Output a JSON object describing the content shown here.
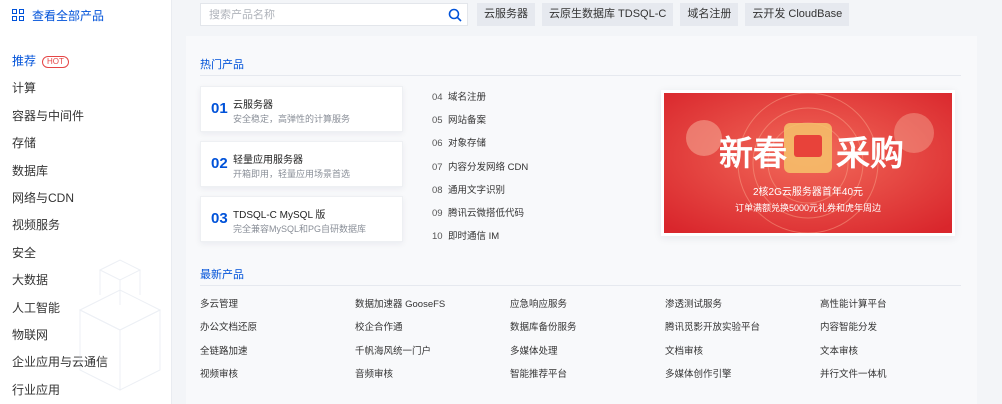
{
  "sidebar": {
    "all_products": "查看全部产品",
    "categories": [
      {
        "label": "推荐",
        "badge": "HOT",
        "active": true
      },
      {
        "label": "计算"
      },
      {
        "label": "容器与中间件"
      },
      {
        "label": "存储"
      },
      {
        "label": "数据库"
      },
      {
        "label": "网络与CDN"
      },
      {
        "label": "视频服务"
      },
      {
        "label": "安全"
      },
      {
        "label": "大数据"
      },
      {
        "label": "人工智能"
      },
      {
        "label": "物联网"
      },
      {
        "label": "企业应用与云通信"
      },
      {
        "label": "行业应用"
      }
    ]
  },
  "search": {
    "placeholder": "搜索产品名称",
    "chips": [
      "云服务器",
      "云原生数据库 TDSQL-C",
      "域名注册",
      "云开发 CloudBase"
    ]
  },
  "hot": {
    "title": "热门产品",
    "cards": [
      {
        "num": "01",
        "title": "云服务器",
        "desc": "安全稳定，高弹性的计算服务"
      },
      {
        "num": "02",
        "title": "轻量应用服务器",
        "desc": "开箱即用，轻量应用场景首选"
      },
      {
        "num": "03",
        "title": "TDSQL-C MySQL 版",
        "desc": "完全兼容MySQL和PG自研数据库"
      }
    ],
    "list": [
      {
        "num": "04",
        "label": "域名注册"
      },
      {
        "num": "05",
        "label": "网站备案"
      },
      {
        "num": "06",
        "label": "对象存储"
      },
      {
        "num": "07",
        "label": "内容分发网络 CDN"
      },
      {
        "num": "08",
        "label": "通用文字识别"
      },
      {
        "num": "09",
        "label": "腾讯云微搭低代码"
      },
      {
        "num": "10",
        "label": "即时通信 IM"
      }
    ],
    "banner": {
      "title_left": "新春",
      "title_right": "采购",
      "line1": "2核2G云服务器首年40元",
      "line2": "订单满额兑换5000元礼券和虎年周边"
    }
  },
  "new": {
    "title": "最新产品",
    "items": [
      "多云管理",
      "数据加速器 GooseFS",
      "应急响应服务",
      "渗透测试服务",
      "高性能计算平台",
      "办公文档还原",
      "校企合作通",
      "数据库备份服务",
      "腾讯觅影开放实验平台",
      "内容智能分发",
      "全链路加速",
      "千帆海风统一门户",
      "多媒体处理",
      "文档审核",
      "文本审核",
      "视频审核",
      "音频审核",
      "智能推荐平台",
      "多媒体创作引擎",
      "并行文件一体机"
    ]
  },
  "colors": {
    "accent": "#0052d9",
    "hot": "#e54545",
    "banner_red": "#e63b3b"
  }
}
